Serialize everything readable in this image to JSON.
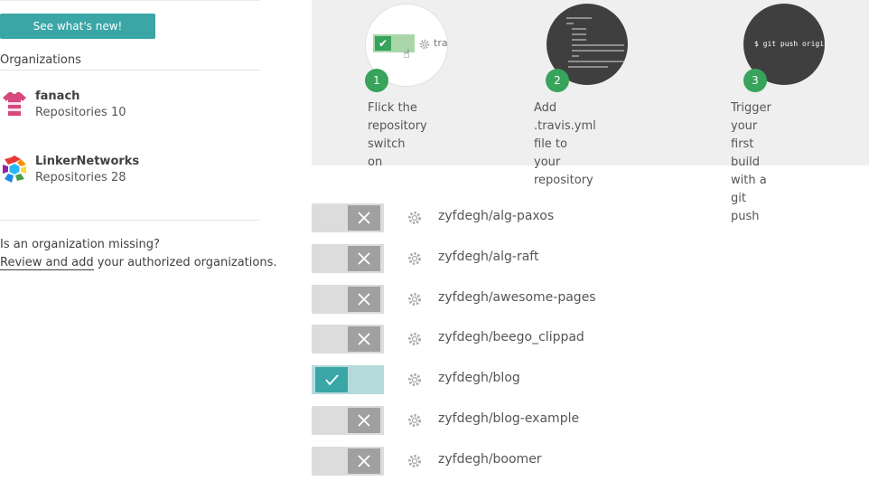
{
  "sidebar": {
    "whats_new_button": "See what's new!",
    "organizations_heading": "Organizations",
    "orgs": [
      {
        "name": "fanach",
        "repos": "Repositories 10"
      },
      {
        "name": "LinkerNetworks",
        "repos": "Repositories 28"
      }
    ],
    "missing_question": "Is an organization missing?",
    "missing_link": "Review and add",
    "missing_rest": " your authorized organizations."
  },
  "guide": {
    "steps": [
      {
        "number": "1",
        "caption_lines": [
          "Flick the",
          "repository switch",
          "on"
        ],
        "preview_text": "tra"
      },
      {
        "number": "2",
        "caption_lines": [
          "Add .travis.yml file to",
          "your repository"
        ]
      },
      {
        "number": "3",
        "caption_lines": [
          "Trigger your first build",
          "with a git push"
        ],
        "preview_text": "$ git push origin"
      }
    ]
  },
  "repos": [
    {
      "name": "zyfdegh/alg-paxos",
      "enabled": false
    },
    {
      "name": "zyfdegh/alg-raft",
      "enabled": false
    },
    {
      "name": "zyfdegh/awesome-pages",
      "enabled": false
    },
    {
      "name": "zyfdegh/beego_clippad",
      "enabled": false
    },
    {
      "name": "zyfdegh/blog",
      "enabled": true
    },
    {
      "name": "zyfdegh/blog-example",
      "enabled": false
    },
    {
      "name": "zyfdegh/boomer",
      "enabled": false
    }
  ],
  "colors": {
    "teal": "#3aa6a6",
    "green": "#37a35b",
    "panel": "#efefef",
    "switch_off": "#dcdcdc"
  }
}
